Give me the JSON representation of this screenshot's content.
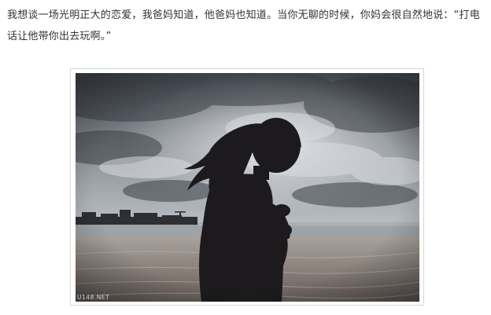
{
  "article": {
    "paragraph": "我想谈一场光明正大的恋爱，我爸妈知道，他爸妈也知道。当你无聊的时候，你妈会很自然地说：“打电话让他带你出去玩啊。”"
  },
  "photo": {
    "subject": "silhouette of a girl with long hair standing on a beach under a cloudy sky",
    "watermark": "U148.NET"
  }
}
